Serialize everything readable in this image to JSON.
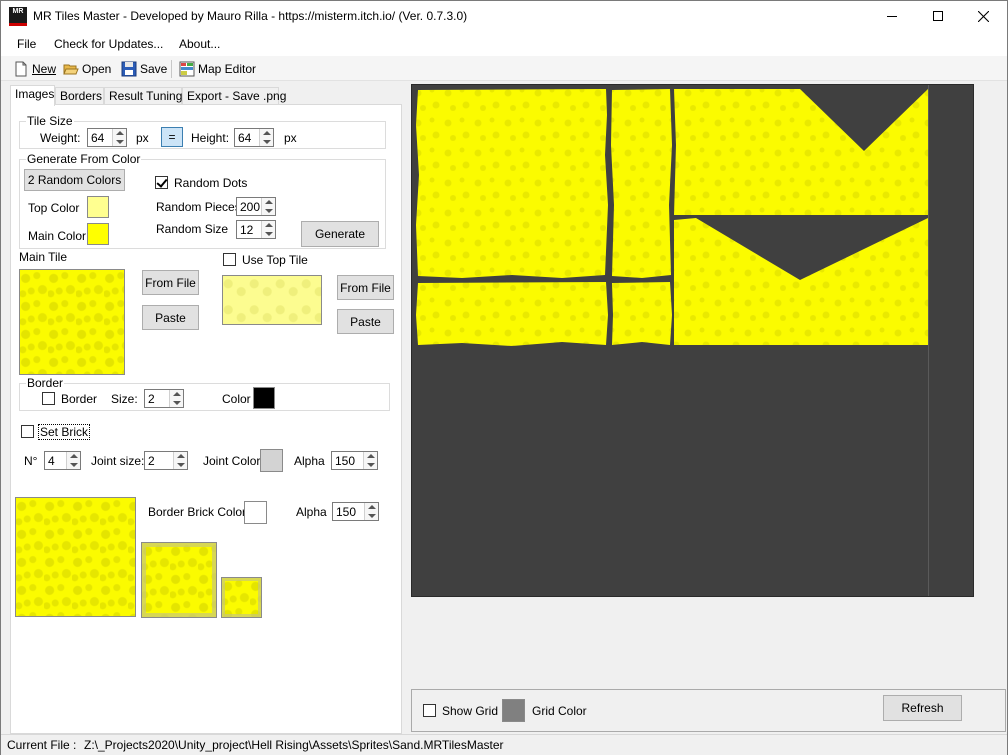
{
  "window": {
    "title": "MR Tiles Master - Developed by Mauro Rilla -  https://misterm.itch.io/ (Ver. 0.7.3.0)",
    "app_icon_text": "MR"
  },
  "menu": {
    "file": "File",
    "check_updates": "Check for Updates...",
    "about": "About..."
  },
  "toolbar": {
    "new": "New",
    "open": "Open",
    "save": "Save",
    "map_editor": "Map Editor"
  },
  "tabs": [
    "Images",
    "Borders",
    "Result Tuning",
    "Export - Save .png"
  ],
  "tile_size": {
    "title": "Tile Size",
    "weight_label": "Weight:",
    "weight_value": "64",
    "px1": "px",
    "equal_label": "=",
    "height_label": "Height:",
    "height_value": "64",
    "px2": "px"
  },
  "generate": {
    "title": "Generate From Color",
    "random_colors_button": "2 Random Colors",
    "random_dots_label": "Random Dots",
    "random_dots_checked": true,
    "top_color_label": "Top Color",
    "top_color": "#ffff90",
    "main_color_label": "Main Color",
    "main_color": "#ffff00",
    "random_pieces_label": "Random Pieces",
    "random_pieces_value": "200",
    "random_size_label": "Random Size",
    "random_size_value": "12",
    "generate_button": "Generate"
  },
  "main_tile": {
    "label": "Main Tile",
    "from_file": "From File",
    "paste": "Paste"
  },
  "top_tile": {
    "use_label": "Use Top Tile",
    "from_file": "From File",
    "paste": "Paste"
  },
  "border": {
    "title": "Border",
    "border_label": "Border",
    "size_label": "Size:",
    "size_value": "2",
    "color_label": "Color",
    "color": "#000000"
  },
  "brick": {
    "set_brick_label": "Set Brick",
    "n_label": "N°",
    "n_value": "4",
    "joint_size_label": "Joint size:",
    "joint_size_value": "2",
    "joint_color_label": "Joint Color",
    "joint_color": "#d3d3d3",
    "alpha_label": "Alpha",
    "alpha_value": "150",
    "border_brick_color_label": "Border Brick Color",
    "border_brick_color": "#ffffff",
    "alpha2_label": "Alpha",
    "alpha2_value": "150"
  },
  "grid": {
    "show_grid_label": "Show Grid",
    "grid_color_label": "Grid Color",
    "grid_color": "#808080",
    "refresh_button": "Refresh"
  },
  "status": {
    "label": "Current File :",
    "path": "Z:\\_Projects2020\\Unity_project\\Hell Rising\\Assets\\Sprites\\Sand.MRTilesMaster"
  },
  "colors": {
    "canvas_bg": "#404040",
    "tile_yellow": "#ffff00"
  }
}
